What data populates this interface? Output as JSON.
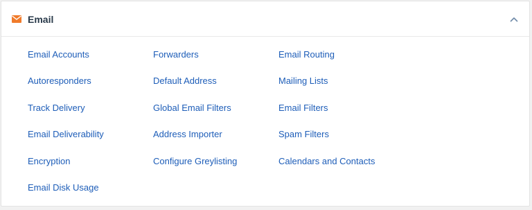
{
  "section": {
    "title": "Email",
    "icon": "envelope-icon",
    "icon_color": "#f07b2b",
    "collapse_icon": "chevron-up-icon",
    "expanded": true
  },
  "colors": {
    "link": "#1d5db8",
    "title": "#293a4a"
  },
  "links": {
    "col0": [
      "Email Accounts",
      "Autoresponders",
      "Track Delivery",
      "Email Deliverability",
      "Encryption",
      "Email Disk Usage"
    ],
    "col1": [
      "Forwarders",
      "Default Address",
      "Global Email Filters",
      "Address Importer",
      "Configure Greylisting"
    ],
    "col2": [
      "Email Routing",
      "Mailing Lists",
      "Email Filters",
      "Spam Filters",
      "Calendars and Contacts"
    ]
  }
}
